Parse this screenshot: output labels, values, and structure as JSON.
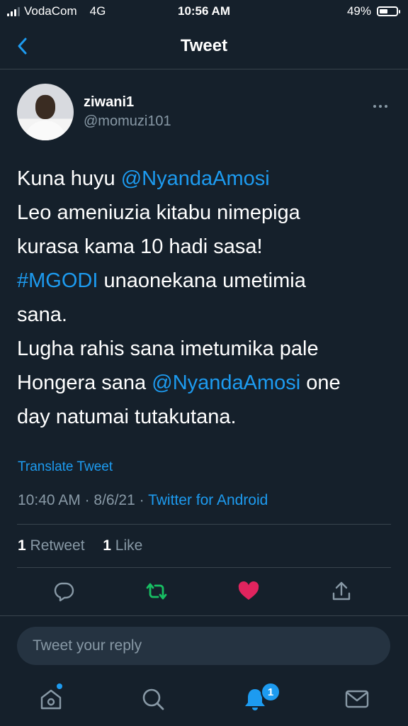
{
  "status_bar": {
    "carrier": "VodaCom",
    "network": "4G",
    "time": "10:56 AM",
    "battery_percent": "49%",
    "battery_level": 0.49,
    "signal_bars": 3
  },
  "nav": {
    "title": "Tweet",
    "back_icon": "chevron-left-icon"
  },
  "author": {
    "display_name": "ziwani1",
    "handle": "@momuzi101",
    "more_icon": "ellipsis-icon"
  },
  "tweet": {
    "lines": [
      [
        {
          "text": "Kuna huyu ",
          "type": "text"
        },
        {
          "text": "@NyandaAmosi",
          "type": "mention"
        }
      ],
      [
        {
          "text": "Leo ameniuzia kitabu nimepiga",
          "type": "text"
        }
      ],
      [
        {
          "text": "kurasa kama 10 hadi sasa!",
          "type": "text"
        }
      ],
      [
        {
          "text": "#MGODI",
          "type": "hashtag"
        },
        {
          "text": " unaonekana umetimia",
          "type": "text"
        }
      ],
      [
        {
          "text": "sana.",
          "type": "text"
        }
      ],
      [
        {
          "text": "Lugha rahis sana imetumika pale",
          "type": "text"
        }
      ],
      [
        {
          "text": "Hongera sana ",
          "type": "text"
        },
        {
          "text": "@NyandaAmosi",
          "type": "mention"
        },
        {
          "text": " one",
          "type": "text"
        }
      ],
      [
        {
          "text": "day natumai tutakutana.",
          "type": "text"
        }
      ]
    ],
    "translate_label": "Translate Tweet",
    "time": "10:40 AM",
    "separator": " · ",
    "date": "8/6/21",
    "source": "Twitter for Android"
  },
  "stats": {
    "retweet_count": "1",
    "retweet_label": " Retweet",
    "like_count": "1",
    "like_label": " Like"
  },
  "actions": [
    {
      "name": "reply",
      "icon": "comment-icon",
      "color": "#8899a6"
    },
    {
      "name": "retweet",
      "icon": "retweet-icon",
      "color": "#17bf63"
    },
    {
      "name": "like",
      "icon": "heart-icon",
      "color": "#e0245e"
    },
    {
      "name": "share",
      "icon": "share-icon",
      "color": "#8899a6"
    }
  ],
  "reply": {
    "placeholder": "Tweet your reply"
  },
  "tab_bar": {
    "notifications_badge": "1",
    "tabs": [
      "home-icon",
      "search-icon",
      "bell-icon",
      "mail-icon"
    ]
  },
  "colors": {
    "background": "#15202b",
    "accent": "#1d9bf0",
    "secondary_text": "#8899a6",
    "divider": "#38444d"
  }
}
